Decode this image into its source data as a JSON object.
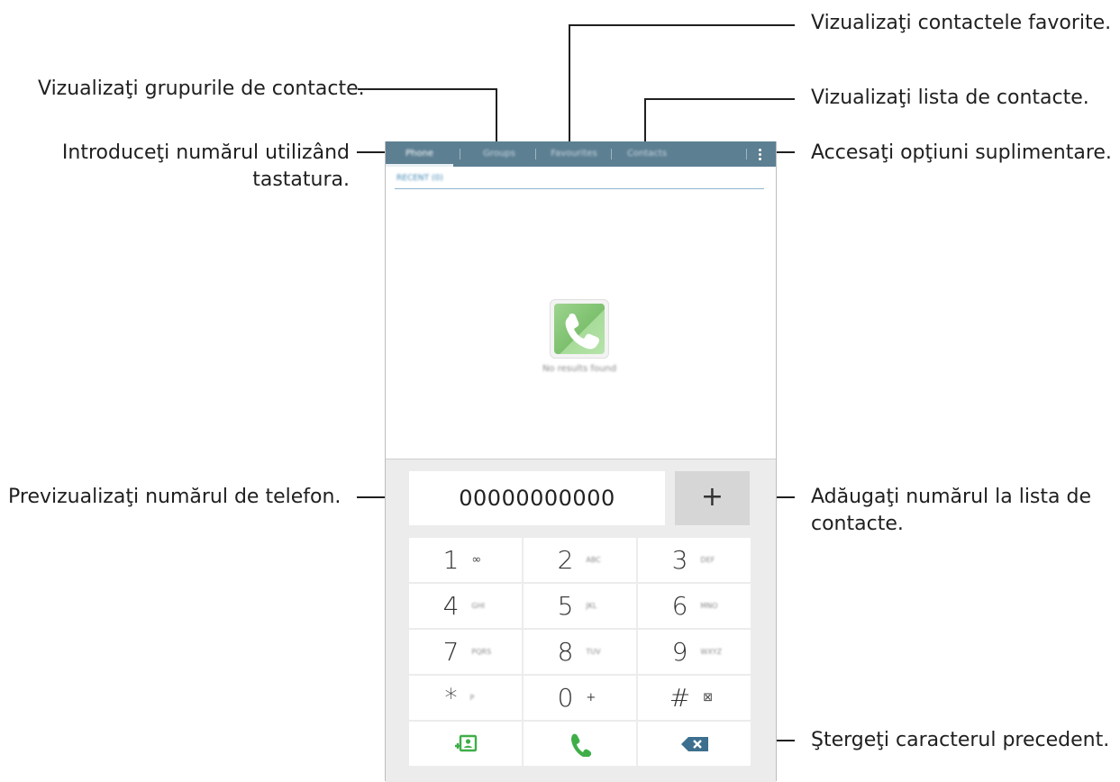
{
  "callouts": {
    "favorites": "Vizualizaţi contactele favorite.",
    "groups": "Vizualizaţi grupurile de contacte.",
    "contacts_list": "Vizualizaţi lista de contacte.",
    "keypad_line1": "Introduceţi numărul utilizând",
    "keypad_line2": "tastatura.",
    "more_options": "Accesaţi opţiuni suplimentare.",
    "preview_number": "Previzualizaţi numărul de telefon.",
    "add_contact_line1": "Adăugaţi numărul la lista de",
    "add_contact_line2": "contacte.",
    "delete_char": "Ştergeţi caracterul precedent."
  },
  "tabs": [
    {
      "label": "Phone"
    },
    {
      "label": "Groups"
    },
    {
      "label": "Favourites"
    },
    {
      "label": "Contacts"
    }
  ],
  "recent_label": "RECENT (0)",
  "empty_state": "No results found",
  "number_field": {
    "value": "00000000000"
  },
  "add_button": {
    "label": "+"
  },
  "keys": [
    {
      "digit": "1",
      "sub": "∞"
    },
    {
      "digit": "2",
      "sub": "ABC"
    },
    {
      "digit": "3",
      "sub": "DEF"
    },
    {
      "digit": "4",
      "sub": "GHI"
    },
    {
      "digit": "5",
      "sub": "JKL"
    },
    {
      "digit": "6",
      "sub": "MNO"
    },
    {
      "digit": "7",
      "sub": "PQRS"
    },
    {
      "digit": "8",
      "sub": "TUV"
    },
    {
      "digit": "9",
      "sub": "WXYZ"
    },
    {
      "digit": "*",
      "sub": "P"
    },
    {
      "digit": "0",
      "sub": "+"
    },
    {
      "digit": "#",
      "sub": "⊠"
    }
  ],
  "colors": {
    "tab_bar": "#5d7f92",
    "call_green": "#3fae49",
    "delete_blue": "#3d6f8e"
  },
  "icons": {
    "contacts_card": "add-contact-icon",
    "call": "call-icon",
    "delete": "backspace-icon",
    "more": "overflow-menu-icon"
  }
}
